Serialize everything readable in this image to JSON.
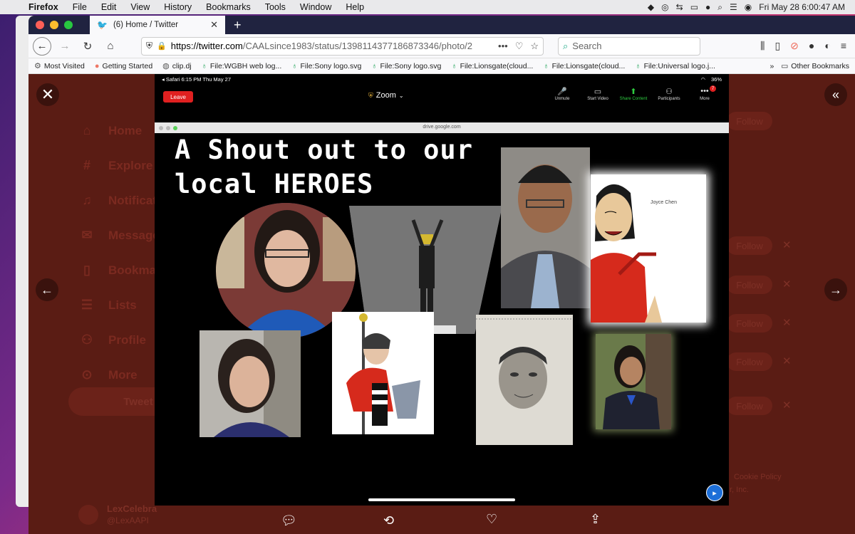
{
  "menubar": {
    "app": "Firefox",
    "items": [
      "File",
      "Edit",
      "View",
      "History",
      "Bookmarks",
      "Tools",
      "Window",
      "Help"
    ],
    "clock": "Fri May 28  6:00:47 AM"
  },
  "browser": {
    "tab_title": "(6) Home / Twitter",
    "url_host": "https://twitter.com",
    "url_path": "/CAALsince1983/status/1398114377186873346/photo/2",
    "search_placeholder": "Search",
    "bookmarks": [
      "Most Visited",
      "Getting Started",
      "clip.dj",
      "File:WGBH web log...",
      "File:Sony logo.svg",
      "File:Sony logo.svg",
      "File:Lionsgate(cloud...",
      "File:Lionsgate(cloud...",
      "File:Universal logo.j..."
    ],
    "other_bookmarks": "Other Bookmarks"
  },
  "twitter_bg": {
    "nav": [
      "Home",
      "Explore",
      "Notificati",
      "Message",
      "Bookmar",
      "Lists",
      "Profile",
      "More"
    ],
    "tweet_button": "Tweet",
    "follow": "Follow",
    "user_name": "LexCelebra",
    "user_handle": "@LexAAPI",
    "cookie": "Cookie Policy",
    "inc": "r, Inc."
  },
  "ipad": {
    "status_left": "◂ Safari  6:15 PM  Thu May 27",
    "battery": "36%",
    "leave": "Leave",
    "zoom_title": "Zoom",
    "tools": [
      {
        "label": "Unmute",
        "icon": "mic-off-icon"
      },
      {
        "label": "Start Video",
        "icon": "video-off-icon"
      },
      {
        "label": "Share Content",
        "icon": "share-icon"
      },
      {
        "label": "Participants",
        "icon": "people-icon"
      },
      {
        "label": "More",
        "icon": "more-icon"
      }
    ],
    "more_badge": "7",
    "shared_address": "drive.google.com",
    "slide_title_line1": "A Shout out to our",
    "slide_title_line2": "local HEROES",
    "joyce_label": "Joyce Chen"
  }
}
